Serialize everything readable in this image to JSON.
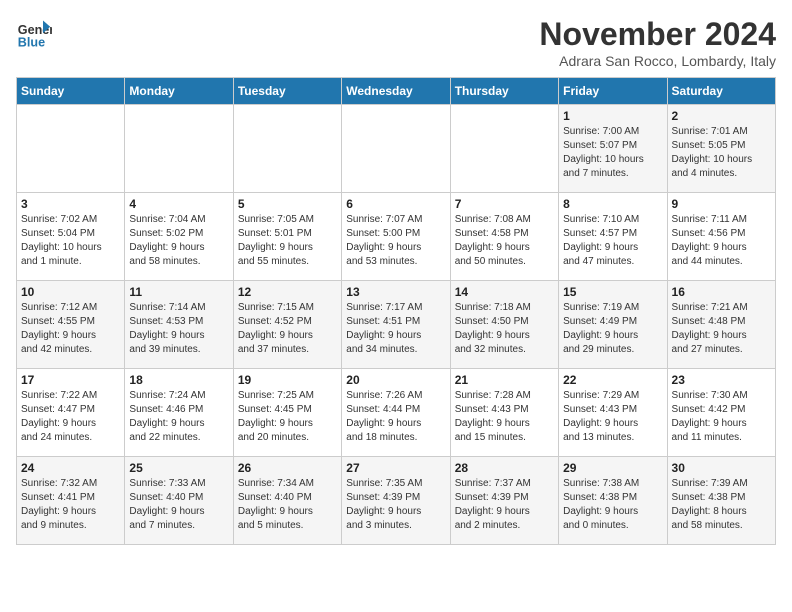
{
  "header": {
    "logo_line1": "General",
    "logo_line2": "Blue",
    "month": "November 2024",
    "location": "Adrara San Rocco, Lombardy, Italy"
  },
  "weekdays": [
    "Sunday",
    "Monday",
    "Tuesday",
    "Wednesday",
    "Thursday",
    "Friday",
    "Saturday"
  ],
  "weeks": [
    [
      {
        "day": "",
        "info": ""
      },
      {
        "day": "",
        "info": ""
      },
      {
        "day": "",
        "info": ""
      },
      {
        "day": "",
        "info": ""
      },
      {
        "day": "",
        "info": ""
      },
      {
        "day": "1",
        "info": "Sunrise: 7:00 AM\nSunset: 5:07 PM\nDaylight: 10 hours\nand 7 minutes."
      },
      {
        "day": "2",
        "info": "Sunrise: 7:01 AM\nSunset: 5:05 PM\nDaylight: 10 hours\nand 4 minutes."
      }
    ],
    [
      {
        "day": "3",
        "info": "Sunrise: 7:02 AM\nSunset: 5:04 PM\nDaylight: 10 hours\nand 1 minute."
      },
      {
        "day": "4",
        "info": "Sunrise: 7:04 AM\nSunset: 5:02 PM\nDaylight: 9 hours\nand 58 minutes."
      },
      {
        "day": "5",
        "info": "Sunrise: 7:05 AM\nSunset: 5:01 PM\nDaylight: 9 hours\nand 55 minutes."
      },
      {
        "day": "6",
        "info": "Sunrise: 7:07 AM\nSunset: 5:00 PM\nDaylight: 9 hours\nand 53 minutes."
      },
      {
        "day": "7",
        "info": "Sunrise: 7:08 AM\nSunset: 4:58 PM\nDaylight: 9 hours\nand 50 minutes."
      },
      {
        "day": "8",
        "info": "Sunrise: 7:10 AM\nSunset: 4:57 PM\nDaylight: 9 hours\nand 47 minutes."
      },
      {
        "day": "9",
        "info": "Sunrise: 7:11 AM\nSunset: 4:56 PM\nDaylight: 9 hours\nand 44 minutes."
      }
    ],
    [
      {
        "day": "10",
        "info": "Sunrise: 7:12 AM\nSunset: 4:55 PM\nDaylight: 9 hours\nand 42 minutes."
      },
      {
        "day": "11",
        "info": "Sunrise: 7:14 AM\nSunset: 4:53 PM\nDaylight: 9 hours\nand 39 minutes."
      },
      {
        "day": "12",
        "info": "Sunrise: 7:15 AM\nSunset: 4:52 PM\nDaylight: 9 hours\nand 37 minutes."
      },
      {
        "day": "13",
        "info": "Sunrise: 7:17 AM\nSunset: 4:51 PM\nDaylight: 9 hours\nand 34 minutes."
      },
      {
        "day": "14",
        "info": "Sunrise: 7:18 AM\nSunset: 4:50 PM\nDaylight: 9 hours\nand 32 minutes."
      },
      {
        "day": "15",
        "info": "Sunrise: 7:19 AM\nSunset: 4:49 PM\nDaylight: 9 hours\nand 29 minutes."
      },
      {
        "day": "16",
        "info": "Sunrise: 7:21 AM\nSunset: 4:48 PM\nDaylight: 9 hours\nand 27 minutes."
      }
    ],
    [
      {
        "day": "17",
        "info": "Sunrise: 7:22 AM\nSunset: 4:47 PM\nDaylight: 9 hours\nand 24 minutes."
      },
      {
        "day": "18",
        "info": "Sunrise: 7:24 AM\nSunset: 4:46 PM\nDaylight: 9 hours\nand 22 minutes."
      },
      {
        "day": "19",
        "info": "Sunrise: 7:25 AM\nSunset: 4:45 PM\nDaylight: 9 hours\nand 20 minutes."
      },
      {
        "day": "20",
        "info": "Sunrise: 7:26 AM\nSunset: 4:44 PM\nDaylight: 9 hours\nand 18 minutes."
      },
      {
        "day": "21",
        "info": "Sunrise: 7:28 AM\nSunset: 4:43 PM\nDaylight: 9 hours\nand 15 minutes."
      },
      {
        "day": "22",
        "info": "Sunrise: 7:29 AM\nSunset: 4:43 PM\nDaylight: 9 hours\nand 13 minutes."
      },
      {
        "day": "23",
        "info": "Sunrise: 7:30 AM\nSunset: 4:42 PM\nDaylight: 9 hours\nand 11 minutes."
      }
    ],
    [
      {
        "day": "24",
        "info": "Sunrise: 7:32 AM\nSunset: 4:41 PM\nDaylight: 9 hours\nand 9 minutes."
      },
      {
        "day": "25",
        "info": "Sunrise: 7:33 AM\nSunset: 4:40 PM\nDaylight: 9 hours\nand 7 minutes."
      },
      {
        "day": "26",
        "info": "Sunrise: 7:34 AM\nSunset: 4:40 PM\nDaylight: 9 hours\nand 5 minutes."
      },
      {
        "day": "27",
        "info": "Sunrise: 7:35 AM\nSunset: 4:39 PM\nDaylight: 9 hours\nand 3 minutes."
      },
      {
        "day": "28",
        "info": "Sunrise: 7:37 AM\nSunset: 4:39 PM\nDaylight: 9 hours\nand 2 minutes."
      },
      {
        "day": "29",
        "info": "Sunrise: 7:38 AM\nSunset: 4:38 PM\nDaylight: 9 hours\nand 0 minutes."
      },
      {
        "day": "30",
        "info": "Sunrise: 7:39 AM\nSunset: 4:38 PM\nDaylight: 8 hours\nand 58 minutes."
      }
    ]
  ]
}
